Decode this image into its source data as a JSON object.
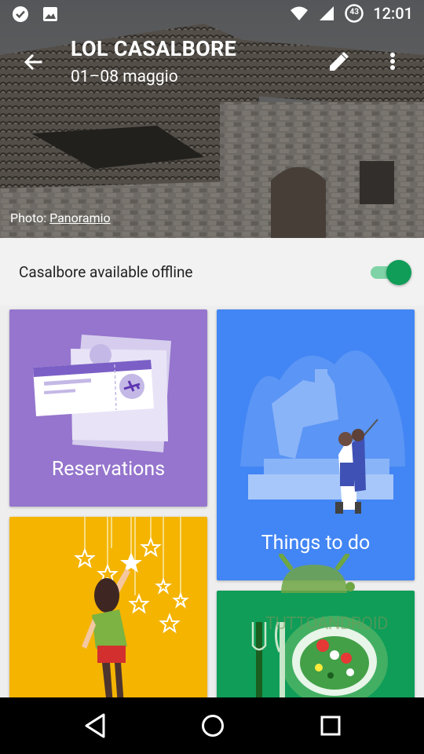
{
  "status_bar": {
    "time": "12:01",
    "battery_level": "43",
    "icons": [
      "check-circle-icon",
      "image-icon",
      "wifi-icon",
      "signal-icon",
      "battery-icon"
    ]
  },
  "appbar": {
    "title": "LOL CASALBORE",
    "subtitle": "01–08 maggio",
    "icons": [
      "back-arrow-icon",
      "edit-pencil-icon",
      "more-vert-icon"
    ]
  },
  "photo_credit": {
    "prefix": "Photo: ",
    "source": "Panoramio"
  },
  "offline": {
    "label": "Casalbore available offline",
    "enabled": true,
    "accent": "#0f9d58"
  },
  "cards": {
    "reservations": {
      "label": "Reservations",
      "color": "#9575cd"
    },
    "things_to_do": {
      "label": "Things to do",
      "color": "#4285f4"
    },
    "yellow_card": {
      "color": "#f4b400"
    },
    "green_card": {
      "color": "#0f9d58"
    }
  },
  "watermark": "TUTTOANDROID",
  "nav_bar": {
    "icons": [
      "back-triangle-icon",
      "home-circle-icon",
      "recents-square-icon"
    ]
  }
}
